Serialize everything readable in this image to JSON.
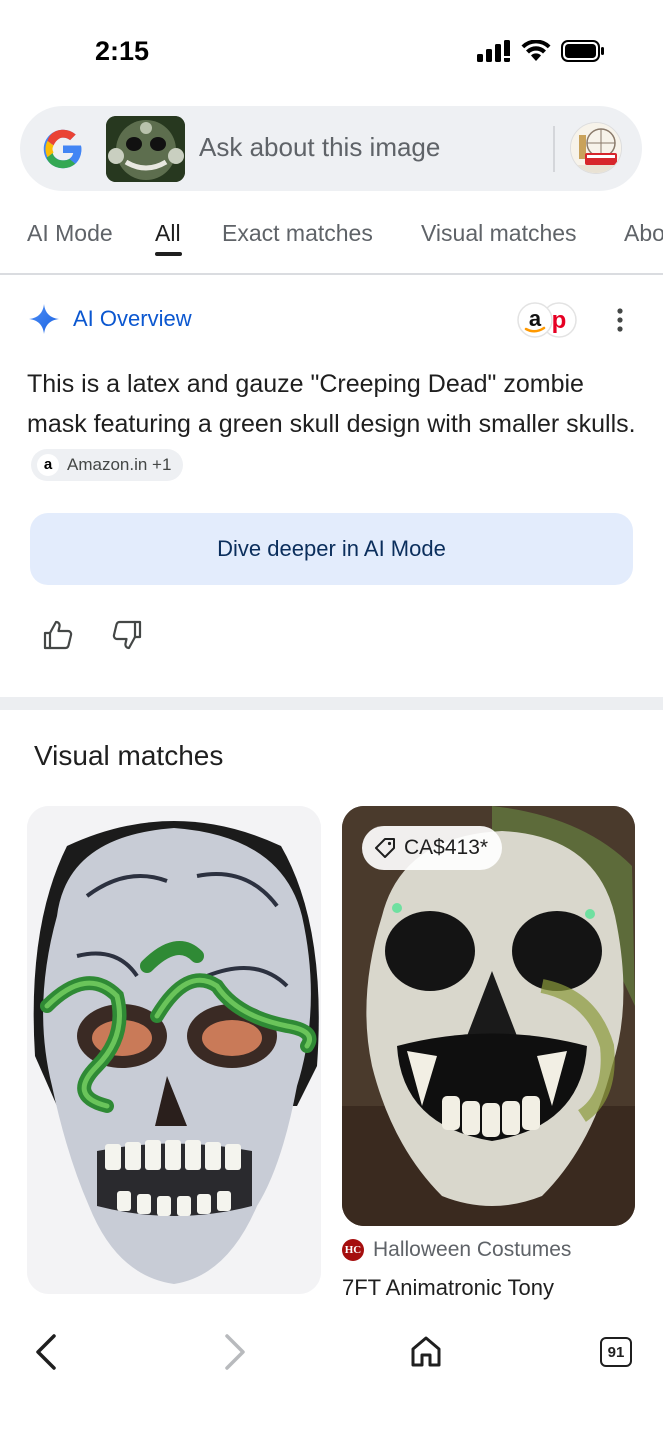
{
  "status_bar": {
    "time": "2:15",
    "icons": [
      "cellular-signal-icon",
      "wifi-icon",
      "battery-icon"
    ]
  },
  "search": {
    "placeholder": "Ask about this image",
    "logo": "google-g-logo",
    "thumbnail": "zombie-mask-thumbnail",
    "avatar": "london-avatar"
  },
  "tabs": [
    {
      "label": "AI Mode",
      "active": false
    },
    {
      "label": "All",
      "active": true
    },
    {
      "label": "Exact matches",
      "active": false
    },
    {
      "label": "Visual matches",
      "active": false
    },
    {
      "label": "Abo",
      "active": false
    }
  ],
  "ai_overview": {
    "title": "AI Overview",
    "body": "This is a latex and gauze \"Creeping Dead\" zombie mask featuring a green skull design with smaller skulls.",
    "source_chip": "Amazon.in +1",
    "source_icon_letter": "a",
    "dive_button": "Dive deeper in AI Mode"
  },
  "visual_matches": {
    "title": "Visual matches",
    "cards": [
      {
        "image": "latex-zombie-skull-mask",
        "price": null,
        "source": "",
        "title": ""
      },
      {
        "image": "animatronic-skull",
        "price": "CA$413*",
        "source": "Halloween Costumes",
        "source_icon": "HC",
        "title": "7FT Animatronic Tony"
      }
    ]
  },
  "bottom_nav": {
    "tab_count": "91"
  },
  "colors": {
    "accent_blue": "#0b57d0",
    "dive_bg": "#e3ecfc",
    "search_bg": "#eef0f3"
  }
}
